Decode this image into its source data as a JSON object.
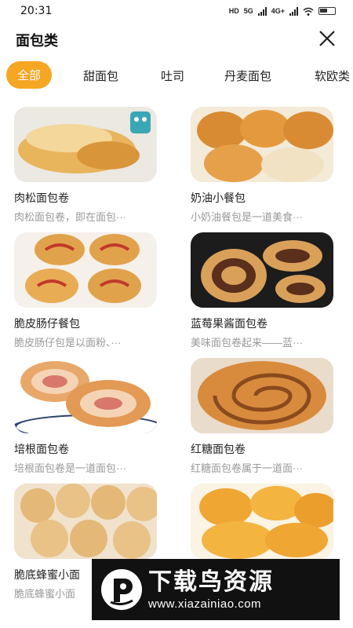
{
  "status_bar": {
    "time": "20:31",
    "indicators": [
      "HD",
      "5G",
      "4G+"
    ]
  },
  "header": {
    "title": "面包类",
    "close_icon": "close-icon"
  },
  "tabs": [
    {
      "label": "全部",
      "active": true
    },
    {
      "label": "甜面包",
      "active": false
    },
    {
      "label": "吐司",
      "active": false
    },
    {
      "label": "丹麦面包",
      "active": false
    },
    {
      "label": "软欧类",
      "active": false
    }
  ],
  "recipes": [
    {
      "title": "肉松面包卷",
      "desc": "肉松面包卷，即在面包···"
    },
    {
      "title": "奶油小餐包",
      "desc": "小奶油餐包是一道美食···"
    },
    {
      "title": "脆皮肠仔餐包",
      "desc": "脆皮肠仔包是以面粉、···"
    },
    {
      "title": "蓝莓果酱面包卷",
      "desc": "美味面包卷起来——蓝···"
    },
    {
      "title": "培根面包卷",
      "desc": "培根面包卷是一道面包···"
    },
    {
      "title": "红糖面包卷",
      "desc": "红糖面包卷属于一道面···"
    },
    {
      "title": "脆底蜂蜜小面",
      "desc": "脆底蜂蜜小面"
    }
  ],
  "watermark": {
    "brand": "下载鸟资源",
    "url": "www.xiazainiao.com"
  },
  "colors": {
    "accent": "#f5a623",
    "desc_text": "#999999"
  }
}
